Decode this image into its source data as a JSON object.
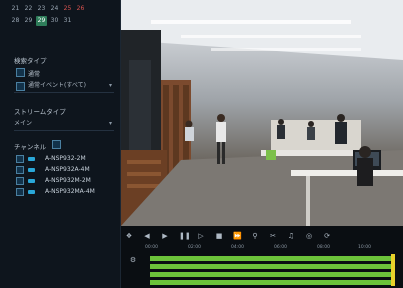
{
  "calendar": {
    "row1": [
      "21",
      "22",
      "23",
      "24",
      "25",
      "26"
    ],
    "row2": [
      "28",
      "29",
      "29",
      "30",
      "31"
    ]
  },
  "sidebar": {
    "search_type_label": "検索タイプ",
    "regular_label": "通常",
    "event_select": "通常イベント(すべて)",
    "stream_type_label": "ストリームタイプ",
    "stream_select": "メイン",
    "channel_label": "チャンネル",
    "channels": [
      "A-NSP932-2M",
      "A-NSP932A-4M",
      "A-NSP932M-2M",
      "A-NSP932MA-4M"
    ]
  },
  "timeline": {
    "ticks": [
      "00:00",
      "02:00",
      "04:00",
      "06:00",
      "08:00",
      "10:00"
    ]
  },
  "colors": {
    "accent": "#2aa7d8",
    "timeline_green": "#6cc23a",
    "timeline_yellow": "#e9d12a",
    "selected_day": "#2e7d5a"
  }
}
